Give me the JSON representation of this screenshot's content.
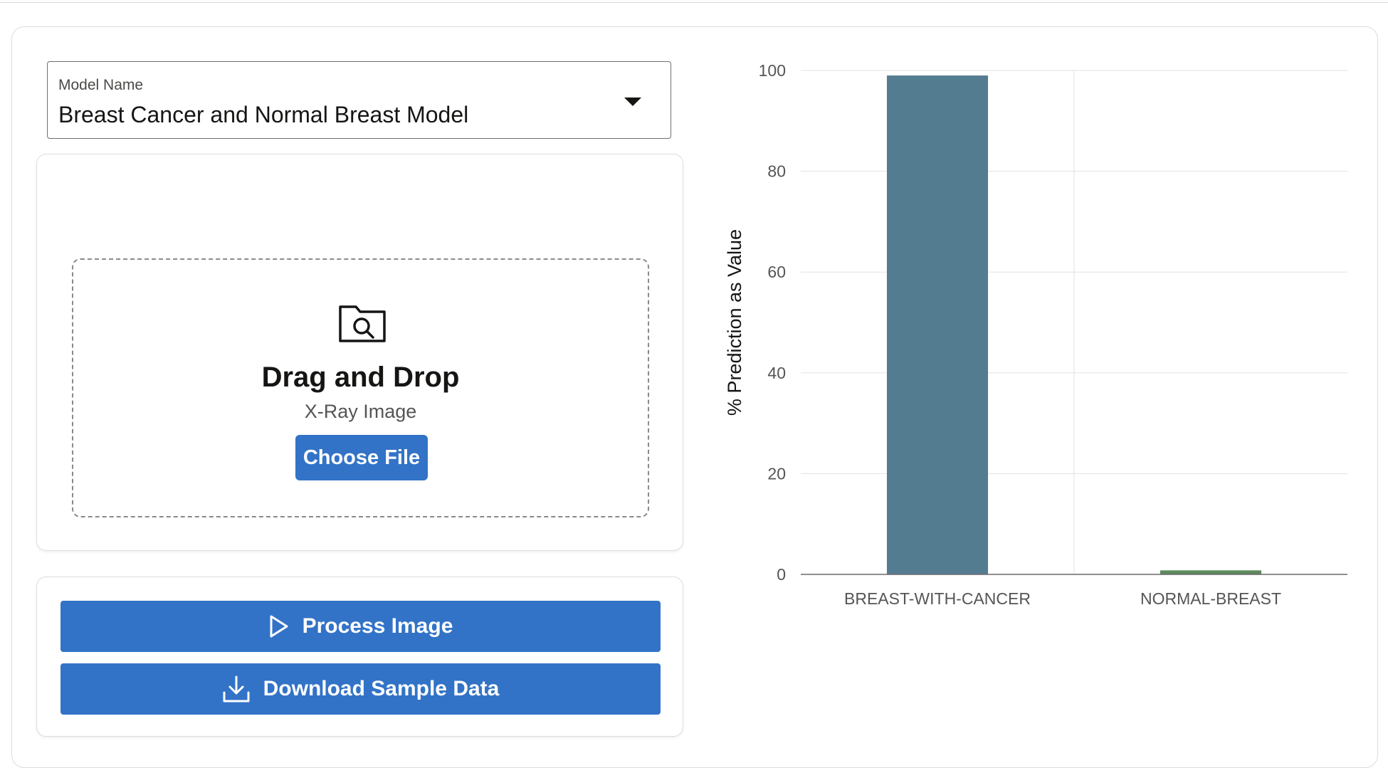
{
  "model_select": {
    "label": "Model Name",
    "value": "Breast Cancer and Normal Breast Model",
    "icon": "chevron-down-icon"
  },
  "upload": {
    "icon": "folder-search-icon",
    "title": "Drag and Drop",
    "subtitle": "X-Ray Image",
    "choose_label": "Choose File"
  },
  "actions": {
    "process_label": "Process Image",
    "process_icon": "play-icon",
    "download_label": "Download Sample Data",
    "download_icon": "download-icon"
  },
  "colors": {
    "primary_button": "#3273c7",
    "bar_cancer": "#537c91",
    "bar_normal": "#5c8a5c"
  },
  "chart_data": {
    "type": "bar",
    "categories": [
      "BREAST-WITH-CANCER",
      "NORMAL-BREAST"
    ],
    "values": [
      99,
      0.8
    ],
    "colors": [
      "#537c91",
      "#5c8a5c"
    ],
    "title": "",
    "xlabel": "",
    "ylabel": "% Prediction as Value",
    "ylim": [
      0,
      100
    ],
    "yticks": [
      "0",
      "20",
      "40",
      "60",
      "80",
      "100"
    ],
    "grid": true,
    "legend": "none"
  }
}
